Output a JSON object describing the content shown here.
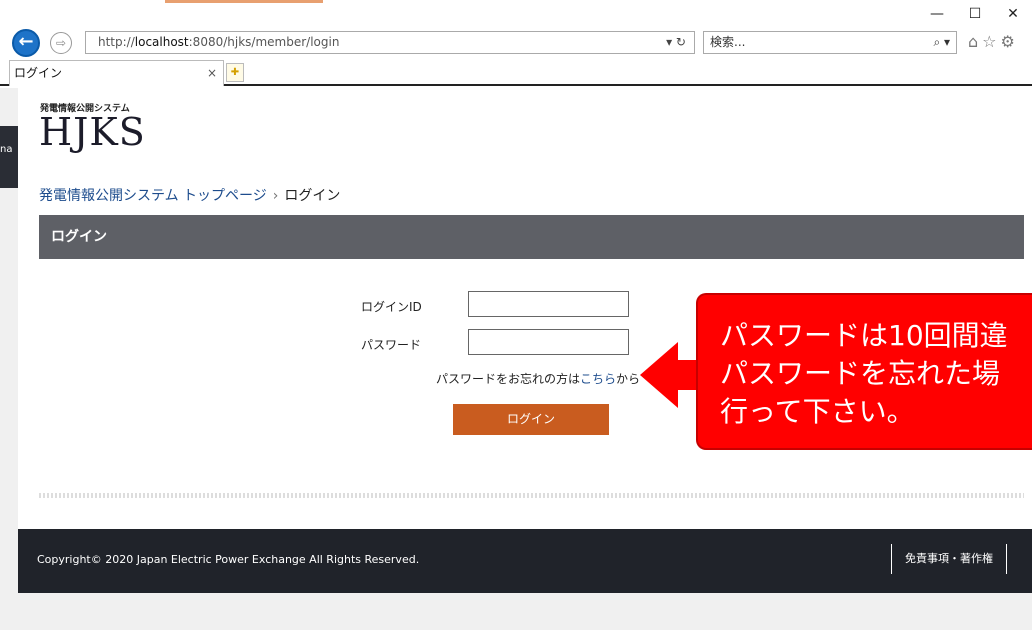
{
  "browser": {
    "url_prefix": "http://",
    "url_host": "localhost",
    "url_rest": ":8080/hjks/member/login",
    "url_controls": "▾ ↻",
    "search_placeholder": "検索...",
    "search_icon": "⌕ ▾",
    "tab_title": "ログイン",
    "tab_close": "×",
    "window_controls": [
      "—",
      "☐",
      "✕"
    ],
    "toolbar_icons": "⌂☆⚙"
  },
  "sliver_text": "na",
  "header": {
    "logo_small": "発電情報公開システム",
    "logo_big": "HJKS"
  },
  "breadcrumb": {
    "home": "発電情報公開システム トップページ",
    "separator": "›",
    "current": "ログイン"
  },
  "section": {
    "title": "ログイン"
  },
  "form": {
    "login_id_label": "ログインID",
    "password_label": "パスワード",
    "forgot_prefix": "パスワードをお忘れの方は",
    "forgot_link": "こちら",
    "forgot_suffix": "から",
    "login_button": "ログイン"
  },
  "footer": {
    "copyright": "Copyright© 2020 Japan Electric Power Exchange All Rights Reserved.",
    "link": "免責事項・著作権"
  },
  "annotation": {
    "line1": "パスワードは10回間違",
    "line2": "パスワードを忘れた場",
    "line3": "行って下さい。"
  }
}
